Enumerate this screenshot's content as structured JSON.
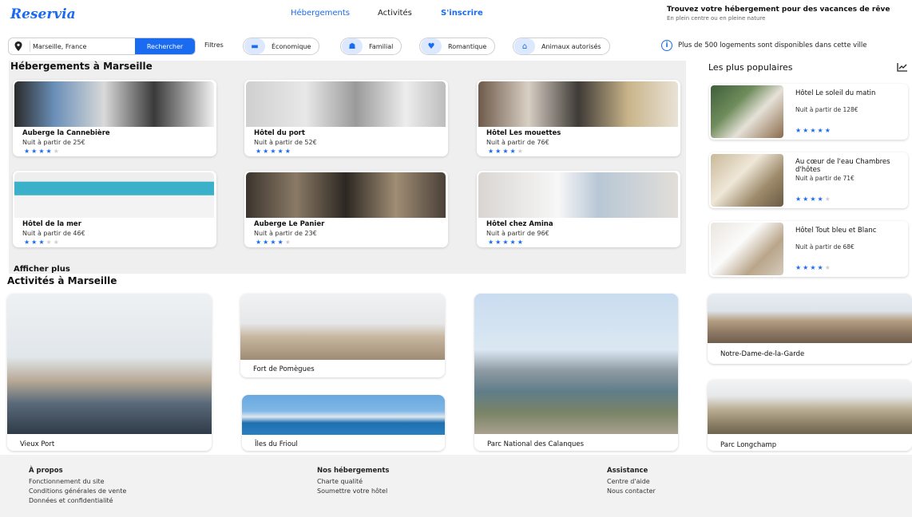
{
  "header": {
    "logo": "Reservia",
    "nav": [
      "Hébergements",
      "Activités",
      "S'inscrire"
    ],
    "tagline": "Trouvez votre hébergement pour des vacances de rêve",
    "subtagline": "En plein centre ou en pleine nature"
  },
  "search": {
    "value": "Marseille, France",
    "button": "Rechercher",
    "filters_label": "Filtres"
  },
  "filters": [
    {
      "label": "Économique",
      "icon": "money-icon"
    },
    {
      "label": "Familial",
      "icon": "family-icon"
    },
    {
      "label": "Romantique",
      "icon": "heart-icon"
    },
    {
      "label": "Animaux autorisés",
      "icon": "pet-icon"
    }
  ],
  "info": {
    "text": "Plus de 500 logements sont disponibles dans cette ville"
  },
  "lodging": {
    "title": "Hébergements à Marseille",
    "show_more": "Afficher plus",
    "cards": [
      {
        "name": "Auberge la Cannebière",
        "price": "Nuit à partir de 25€",
        "rating": 4
      },
      {
        "name": "Hôtel du port",
        "price": "Nuit à partir de 52€",
        "rating": 5
      },
      {
        "name": "Hôtel Les mouettes",
        "price": "Nuit à partir de 76€",
        "rating": 4
      },
      {
        "name": "Hôtel de la mer",
        "price": "Nuit à partir de 46€",
        "rating": 3
      },
      {
        "name": "Auberge Le Panier",
        "price": "Nuit à partir de 23€",
        "rating": 4
      },
      {
        "name": "Hôtel chez Amina",
        "price": "Nuit à partir de 96€",
        "rating": 5
      }
    ]
  },
  "popular": {
    "title": "Les plus populaires",
    "items": [
      {
        "name": "Hôtel Le soleil du matin",
        "price": "Nuit à partir de 128€",
        "rating": 5
      },
      {
        "name": "Au cœur de l'eau Chambres d'hôtes",
        "price": "Nuit à partir de 71€",
        "rating": 4
      },
      {
        "name": "Hôtel Tout bleu et Blanc",
        "price": "Nuit à partir de 68€",
        "rating": 4
      }
    ]
  },
  "activities": {
    "title": "Activités à Marseille",
    "items": [
      "Vieux Port",
      "Fort de Pomègues",
      "Îles du Frioul",
      "Parc National des Calanques",
      "Notre-Dame-de-la-Garde",
      "Parc Longchamp"
    ]
  },
  "footer": {
    "columns": [
      {
        "title": "À propos",
        "links": [
          "Fonctionnement du site",
          "Conditions générales de vente",
          "Données et confidentialité"
        ]
      },
      {
        "title": "Nos hébergements",
        "links": [
          "Charte qualité",
          "Soumettre votre hôtel"
        ]
      },
      {
        "title": "Assistance",
        "links": [
          "Centre d'aide",
          "Nous contacter"
        ]
      }
    ]
  },
  "colors": {
    "accent": "#1a6bf0",
    "panel": "#efefef",
    "star_off": "#cfcfcf"
  }
}
